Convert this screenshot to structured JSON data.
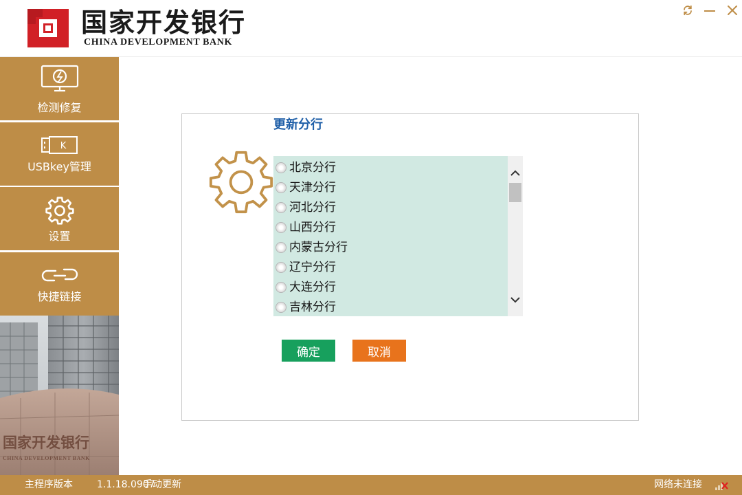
{
  "app": {
    "name_cn": "国家开发银行",
    "name_en": "CHINA DEVELOPMENT BANK",
    "brand_color": "#be8d47",
    "logo_red": "#d12026"
  },
  "window_controls": {
    "refresh_icon": "refresh-icon",
    "minimize_icon": "minimize-icon",
    "close_icon": "close-icon"
  },
  "sidebar": {
    "items": [
      {
        "label": "检测修复",
        "icon": "monitor-repair-icon"
      },
      {
        "label": "USBkey管理",
        "icon": "usbkey-icon"
      },
      {
        "label": "设置",
        "icon": "gear-icon"
      },
      {
        "label": "快捷链接",
        "icon": "link-icon"
      }
    ],
    "photo_caption": "国家开发银行",
    "photo_caption_en": "CHINA DEVELOPMENT BANK"
  },
  "panel": {
    "title": "更新分行",
    "branches": [
      "北京分行",
      "天津分行",
      "河北分行",
      "山西分行",
      "内蒙古分行",
      "辽宁分行",
      "大连分行",
      "吉林分行"
    ],
    "list_background": "#d1e9e2",
    "ok_label": "确定",
    "cancel_label": "取消",
    "ok_color": "#17a05d",
    "cancel_color": "#e8731c"
  },
  "footer": {
    "version_label": "主程序版本",
    "version": "1.1.18.0907",
    "manual_update": "手动更新",
    "network_status": "网络未连接"
  }
}
